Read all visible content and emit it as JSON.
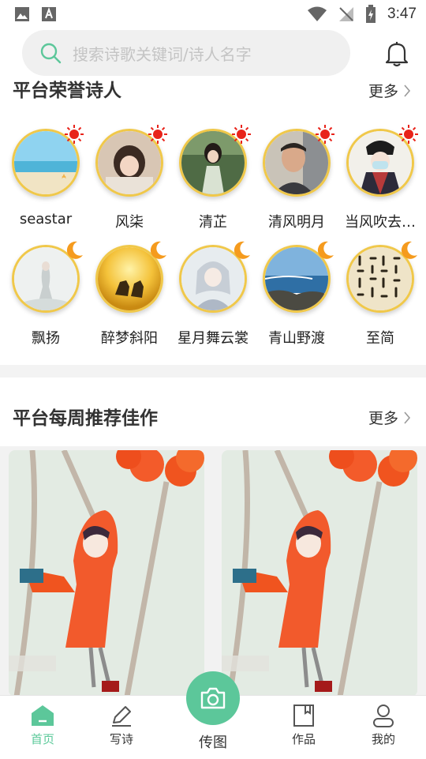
{
  "status": {
    "time": "3:47"
  },
  "search": {
    "placeholder": "搜索诗歌关键词/诗人名字"
  },
  "honor": {
    "title": "平台荣誉诗人",
    "more_label": "更多",
    "poets": [
      {
        "name": "seastar",
        "badge": "sun"
      },
      {
        "name": "风柒",
        "badge": "sun"
      },
      {
        "name": "清芷",
        "badge": "sun"
      },
      {
        "name": "清风明月",
        "badge": "sun"
      },
      {
        "name": "当风吹去…",
        "badge": "sun"
      },
      {
        "name": "飘扬",
        "badge": "moon"
      },
      {
        "name": "醉梦斜阳",
        "badge": "moon"
      },
      {
        "name": "星月舞云裳",
        "badge": "moon"
      },
      {
        "name": "青山野渡",
        "badge": "moon"
      },
      {
        "name": "至简",
        "badge": "moon"
      }
    ]
  },
  "weekly": {
    "title": "平台每周推荐佳作",
    "more_label": "更多"
  },
  "tabs": {
    "home": "首页",
    "write": "写诗",
    "post": "传图",
    "works": "作品",
    "mine": "我的"
  },
  "colors": {
    "accent": "#5cc79a",
    "sun": "#e8231a",
    "moon": "#f59b1e",
    "avatar_border": "#f0c84a"
  }
}
